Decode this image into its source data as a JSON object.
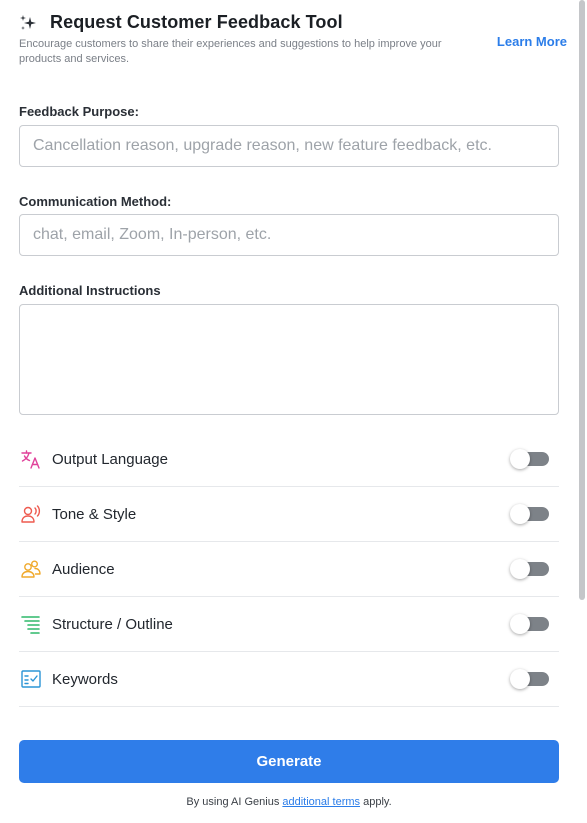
{
  "header": {
    "title": "Request Customer Feedback Tool",
    "subtitle": "Encourage customers to share their experiences and suggestions to help improve your products and services.",
    "learn_more": "Learn More",
    "icon": "sparkle-icon"
  },
  "fields": {
    "purpose": {
      "label": "Feedback Purpose:",
      "placeholder": "Cancellation reason, upgrade reason, new feature feedback, etc.",
      "value": ""
    },
    "method": {
      "label": "Communication Method:",
      "placeholder": "chat, email, Zoom, In-person, etc.",
      "value": ""
    },
    "instructions": {
      "label": "Additional Instructions",
      "value": ""
    }
  },
  "options": [
    {
      "label": "Output Language",
      "icon": "translate-icon",
      "color": "#e0419a",
      "enabled": false
    },
    {
      "label": "Tone & Style",
      "icon": "voice-icon",
      "color": "#ee5a4f",
      "enabled": false
    },
    {
      "label": "Audience",
      "icon": "audience-icon",
      "color": "#f0a92b",
      "enabled": false
    },
    {
      "label": "Structure / Outline",
      "icon": "outline-icon",
      "color": "#2fb86a",
      "enabled": false
    },
    {
      "label": "Keywords",
      "icon": "keywords-icon",
      "color": "#2b95d6",
      "enabled": false
    }
  ],
  "footer": {
    "generate": "Generate",
    "terms_prefix": "By using AI Genius ",
    "terms_link": "additional terms",
    "terms_suffix": " apply."
  },
  "colors": {
    "accent": "#2f7de9",
    "link": "#2b7de9",
    "toggle_off": "#7d8288"
  }
}
